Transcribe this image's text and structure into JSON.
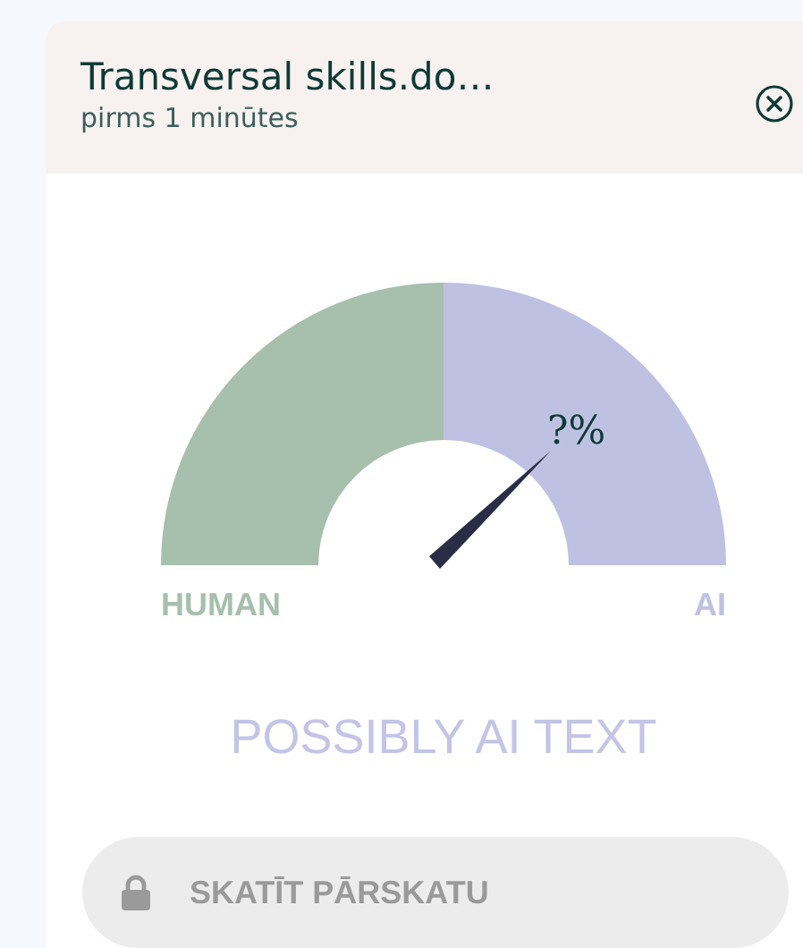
{
  "document": {
    "title": "Transversal skills.do…",
    "time": "pirms 1 minūtes"
  },
  "gauge": {
    "reading": "?%",
    "left_label": "HUMAN",
    "right_label": "AI"
  },
  "verdict": "POSSIBLY AI TEXT",
  "report_button": {
    "label": "SKATĪT PĀRSKATU",
    "disabled": true
  }
}
